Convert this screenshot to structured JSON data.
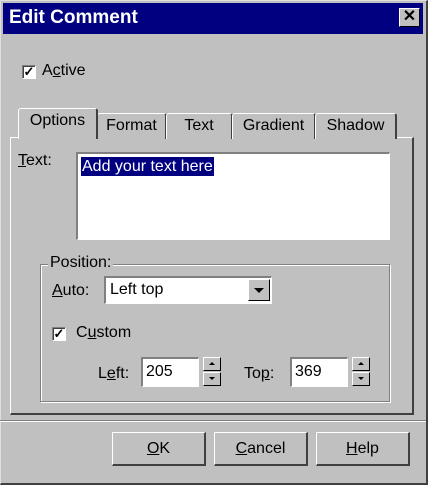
{
  "window": {
    "title": "Edit Comment",
    "close_glyph": "✕"
  },
  "active": {
    "label_pre": "A",
    "label_u": "c",
    "label_post": "tive",
    "checked": true,
    "check_glyph": "✓"
  },
  "tabs": [
    {
      "label": "Options",
      "active": true
    },
    {
      "label": "Format",
      "active": false
    },
    {
      "label": "Text",
      "active": false
    },
    {
      "label": "Gradient",
      "active": false
    },
    {
      "label": "Shadow",
      "active": false
    }
  ],
  "text_field": {
    "label_u": "T",
    "label_post": "ext:",
    "value": "Add your text here"
  },
  "position": {
    "group_label": "Position:",
    "auto_label_u": "A",
    "auto_label_post": "uto:",
    "auto_value": "Left top",
    "custom_label_pre": "C",
    "custom_label_u": "u",
    "custom_label_post": "stom",
    "custom_checked": true,
    "left_label_pre": "L",
    "left_label_u": "e",
    "left_label_post": "ft:",
    "left_value": "205",
    "top_label_pre": "To",
    "top_label_u": "p",
    "top_label_post": ":",
    "top_value": "369"
  },
  "buttons": {
    "ok_u": "O",
    "ok_post": "K",
    "cancel_u": "C",
    "cancel_post": "ancel",
    "help_u": "H",
    "help_post": "elp"
  }
}
